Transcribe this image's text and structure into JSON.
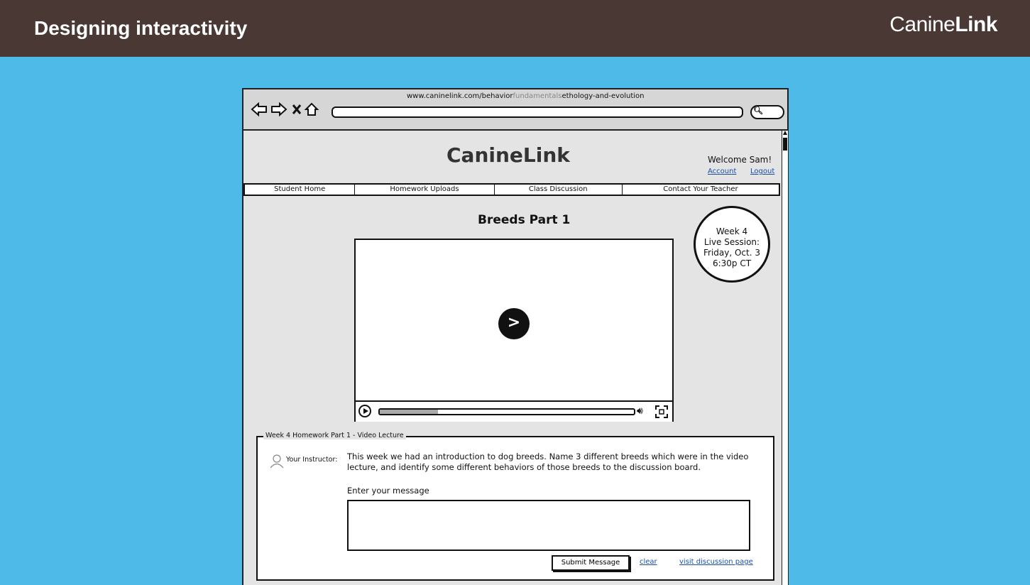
{
  "slide": {
    "title": "Designing interactivity",
    "brand_prefix": "Canine",
    "brand_suffix": "Link"
  },
  "browser": {
    "url_prefix": "www.caninelink.com/behavior",
    "url_middle": "fundamentals",
    "url_suffix": "ethology-and-evolution",
    "search_icon": "search-icon"
  },
  "site": {
    "logo": "CanineLink",
    "welcome": "Welcome Sam!",
    "account_link": "Account",
    "logout_link": "Logout",
    "tabs": [
      {
        "label": "Student Home"
      },
      {
        "label": "Homework Uploads"
      },
      {
        "label": "Class Discussion"
      },
      {
        "label": "Contact Your Teacher"
      }
    ]
  },
  "video": {
    "title": "Breeds Part 1",
    "progress": 0.23
  },
  "live_session": {
    "line1": "Week 4",
    "line2": "Live Session:",
    "line3": "Friday, Oct. 3",
    "line4": "6:30p CT"
  },
  "homework": {
    "legend": "Week 4 Homework Part 1 - Video Lecture",
    "instructor_label": "Your Instructor:",
    "prompt": "This week we had an introduction to dog breeds. Name 3 different breeds which were in the video lecture, and identify some different behaviors of those breeds to the discussion board.",
    "message_label": "Enter your message",
    "message_value": "",
    "submit_label": "Submit Message",
    "clear_label": "clear",
    "discussion_link": "visit discussion page"
  }
}
